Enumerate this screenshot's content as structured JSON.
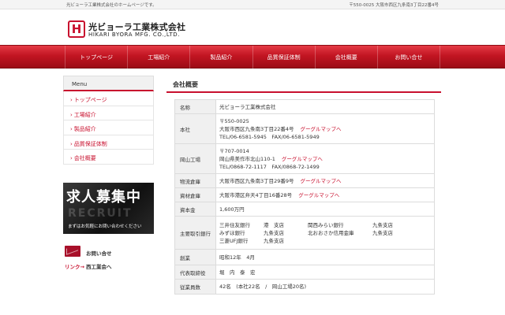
{
  "topbar": {
    "left": "光ビョーラ工業株式会社のホームページです。",
    "right": "〒550-0025 大阪市西区九条南3丁目22番4号"
  },
  "logo": {
    "mark": "H",
    "name_jp": "光ビョーラ工業株式会社",
    "name_en": "HIKARI BYORA MFG. CO.,LTD."
  },
  "nav": {
    "items": [
      "トップページ",
      "工場紹介",
      "製品紹介",
      "品質保証体制",
      "会社概要",
      "お問い合せ"
    ]
  },
  "sidebar": {
    "menu_title": "Menu",
    "items": [
      "トップページ",
      "工場紹介",
      "製品紹介",
      "品質保証体制",
      "会社概要"
    ],
    "recruit": {
      "title": "求人募集中",
      "bg_text": "RECRUIT",
      "sub": "まずはお気軽にお問い合わせください"
    },
    "contact_label": "お問い合せ",
    "link_label": "リンク→",
    "link_value": "西工業会へ"
  },
  "content": {
    "title": "会社概要",
    "map_label": "グーグルマップへ",
    "rows": {
      "name": {
        "label": "名称",
        "value": "光ビョーラ工業株式会社"
      },
      "hq": {
        "label": "本社",
        "zip": "〒550-0025",
        "address": "大阪市西区九条南3丁目22番4号",
        "tel": "TEL/06-6581-5945　FAX/06-6581-5949"
      },
      "okayama": {
        "label": "岡山工場",
        "zip": "〒707-0014",
        "address": "岡山県美作市北山110-1",
        "tel": "TEL/0868-72-1117　FAX/0868-72-1499"
      },
      "warehouse1": {
        "label": "物流倉庫",
        "address": "大阪市西区九条南3丁目29番9号"
      },
      "warehouse2": {
        "label": "資材倉庫",
        "address": "大阪市港区弁天4丁目16番28号"
      },
      "capital": {
        "label": "資本金",
        "value": "1,600万円"
      },
      "banks": {
        "label": "主要取引銀行",
        "cells": [
          "三井住友銀行",
          "港　支店",
          "関西みらい銀行",
          "九条支店",
          "みずほ銀行",
          "九条支店",
          "北おおさか信用金庫",
          "九条支店",
          "三菱UFJ銀行",
          "九条支店",
          "",
          ""
        ]
      },
      "founded": {
        "label": "創業",
        "value": "昭和12年　4月"
      },
      "ceo": {
        "label": "代表取締役",
        "value": "堀　内　泰　宏"
      },
      "employees": {
        "label": "従業員数",
        "value": "42名　(本社22名　/　岡山工場20名)"
      }
    }
  }
}
